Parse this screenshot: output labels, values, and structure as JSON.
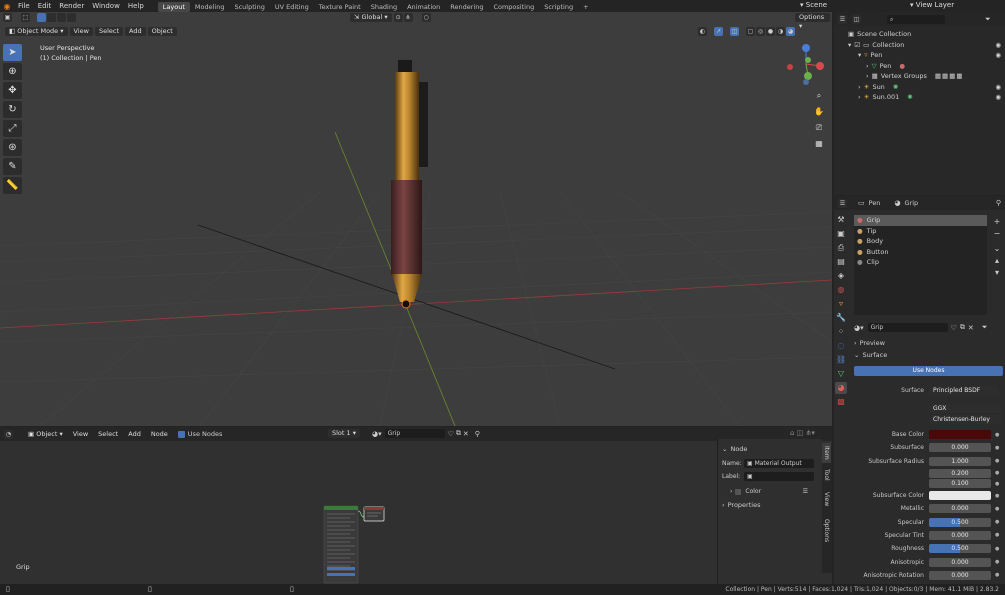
{
  "topbar": {
    "menus": [
      "File",
      "Edit",
      "Render",
      "Window",
      "Help"
    ],
    "workspaces": [
      "Layout",
      "Modeling",
      "Sculpting",
      "UV Editing",
      "Texture Paint",
      "Shading",
      "Animation",
      "Rendering",
      "Compositing",
      "Scripting"
    ],
    "active_workspace": "Layout",
    "scene": "Scene",
    "view_layer": "View Layer"
  },
  "viewport": {
    "mode": "Object Mode",
    "menus": [
      "View",
      "Select",
      "Add",
      "Object"
    ],
    "transform": "Global",
    "options": "Options",
    "overlay_title": "User Perspective",
    "overlay_sub": "(1) Collection | Pen",
    "tools": [
      "cursor",
      "move",
      "rotate",
      "scale",
      "transform",
      "annotate",
      "measure"
    ]
  },
  "outliner": {
    "items": [
      {
        "label": "Scene Collection",
        "indent": 0
      },
      {
        "label": "Collection",
        "indent": 1
      },
      {
        "label": "Pen",
        "indent": 2
      },
      {
        "label": "Pen",
        "indent": 3
      },
      {
        "label": "Vertex Groups",
        "indent": 3
      },
      {
        "label": "Sun",
        "indent": 2
      },
      {
        "label": "Sun.001",
        "indent": 2
      }
    ]
  },
  "properties": {
    "object_name": "Pen",
    "material_name": "Grip",
    "slots": [
      "Grip",
      "Tip",
      "Body",
      "Button",
      "Clip"
    ],
    "selected_slot": "Grip",
    "material_field": "Grip",
    "sections": {
      "preview": "Preview",
      "surface": "Surface"
    },
    "use_nodes": "Use Nodes",
    "surface_label": "Surface",
    "surface_value": "Principled BSDF",
    "distribution": "GGX",
    "subsurface_method": "Christensen-Burley",
    "params": [
      {
        "label": "Base Color",
        "value": "",
        "kind": "color",
        "color": "#4a0808"
      },
      {
        "label": "Subsurface",
        "value": "0.000"
      },
      {
        "label": "Subsurface Radius",
        "value": "1.000"
      },
      {
        "label": "",
        "value": "0.200"
      },
      {
        "label": "",
        "value": "0.100"
      },
      {
        "label": "Subsurface Color",
        "value": "",
        "kind": "color",
        "color": "#e8e8e8"
      },
      {
        "label": "Metallic",
        "value": "0.000"
      },
      {
        "label": "Specular",
        "value": "0.500",
        "fill": 0.5
      },
      {
        "label": "Specular Tint",
        "value": "0.000"
      },
      {
        "label": "Roughness",
        "value": "0.500",
        "fill": 0.5
      },
      {
        "label": "Anisotropic",
        "value": "0.000"
      },
      {
        "label": "Anisotropic Rotation",
        "value": "0.000"
      }
    ]
  },
  "node_editor": {
    "type": "Object",
    "menus": [
      "View",
      "Select",
      "Add",
      "Node"
    ],
    "use_nodes": "Use Nodes",
    "slot": "Slot 1",
    "material": "Grip",
    "frame_label": "Grip",
    "panel": {
      "section": "Node",
      "name_label": "Name:",
      "name_value": "Material Output",
      "label_label": "Label:",
      "color": "Color",
      "properties": "Properties"
    },
    "side_tabs": [
      "Item",
      "Tool",
      "View",
      "Options"
    ]
  },
  "status": {
    "text": "Collection | Pen | Verts:514 | Faces:1,024 | Tris:1,024 | Objects:0/3 | Mem: 41.1 MiB | 2.83.2"
  },
  "colors": {
    "accent": "#4772b3",
    "background": "#3d3d3d"
  }
}
